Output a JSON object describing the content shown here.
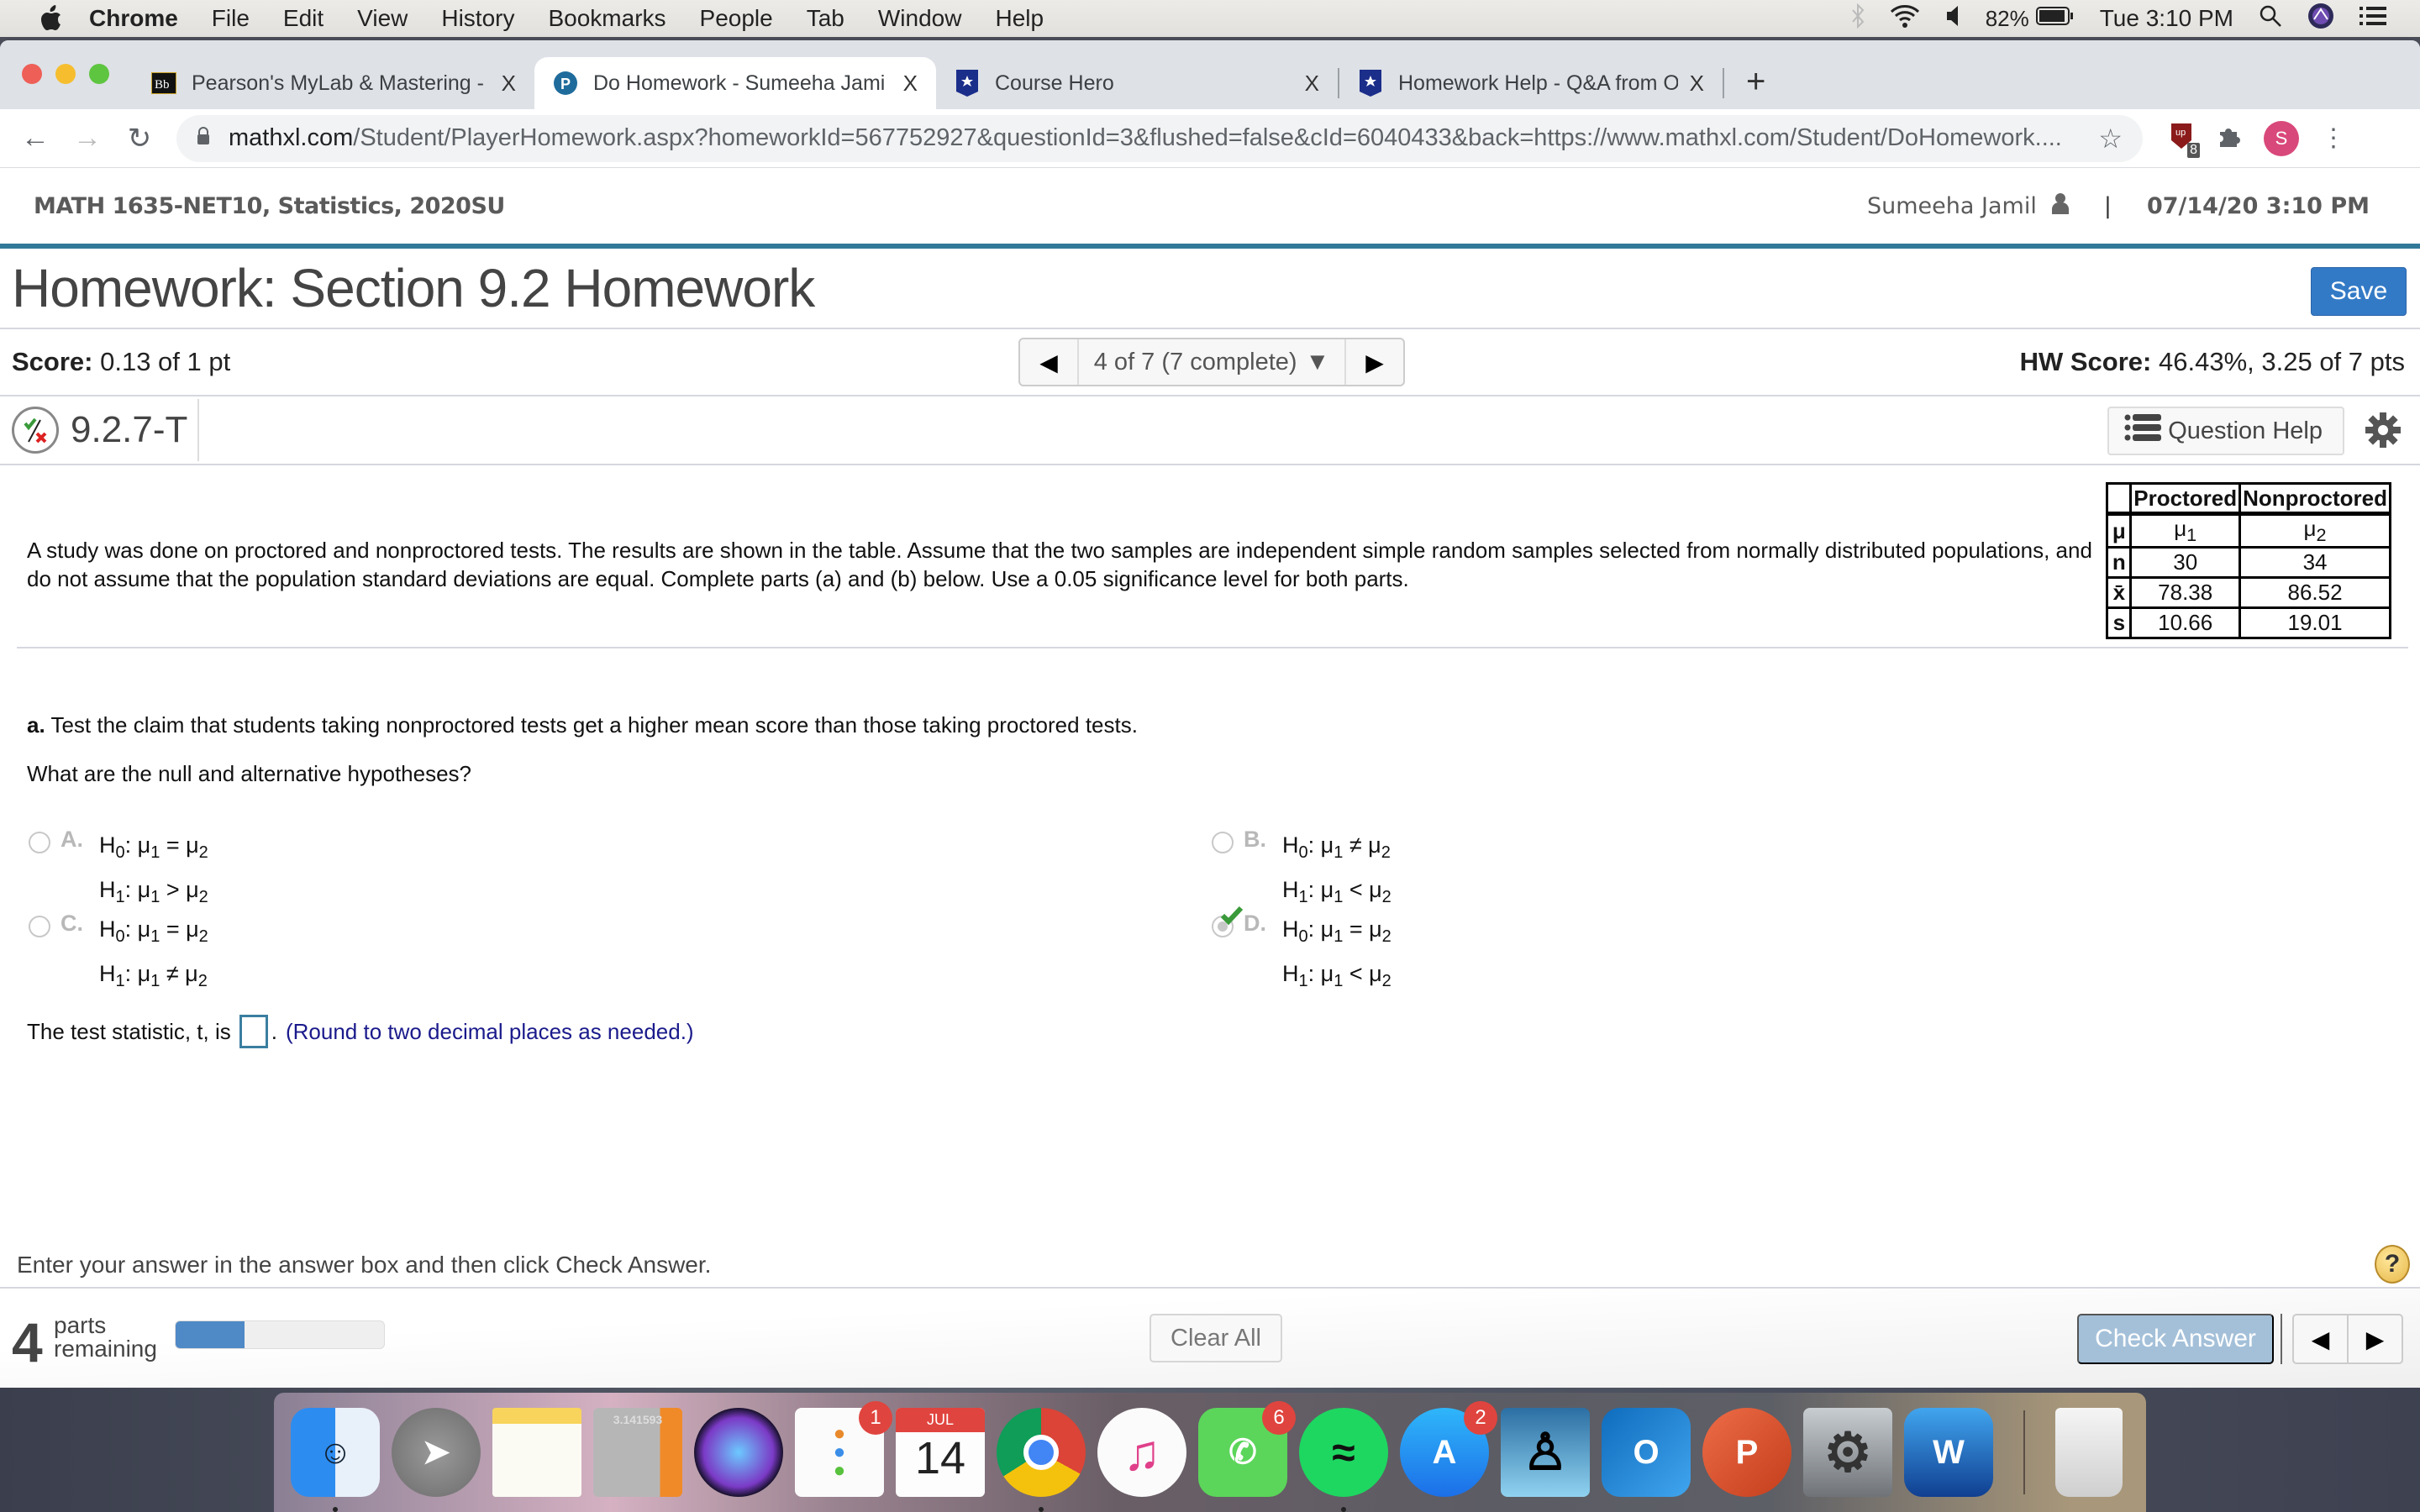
{
  "menubar": {
    "items": [
      "Chrome",
      "File",
      "Edit",
      "View",
      "History",
      "Bookmarks",
      "People",
      "Tab",
      "Window",
      "Help"
    ],
    "battery": "82%",
    "clock": "Tue 3:10 PM"
  },
  "browser": {
    "tabs": [
      {
        "title": "Pearson's MyLab & Mastering -",
        "favicon": "blackboard-icon",
        "active": false
      },
      {
        "title": "Do Homework - Sumeeha Jami",
        "favicon": "pearson-icon",
        "active": true
      },
      {
        "title": "Course Hero",
        "favicon": "coursehero-icon",
        "active": false
      },
      {
        "title": "Homework Help - Q&A from Or",
        "favicon": "coursehero-icon",
        "active": false
      }
    ],
    "close_glyph": "X",
    "new_tab_glyph": "+",
    "url_host": "mathxl.com",
    "url_path": "/Student/PlayerHomework.aspx?homeworkId=567752927&questionId=3&flushed=false&cId=6040433&back=https://www.mathxl.com/Student/DoHomework....",
    "extension_badge": "8",
    "profile_initial": "S"
  },
  "header": {
    "course": "MATH 1635-NET10, Statistics, 2020SU",
    "user": "Sumeeha Jamil",
    "datetime": "07/14/20 3:10 PM",
    "separator": "|"
  },
  "homework": {
    "title": "Homework: Section 9.2 Homework",
    "save_label": "Save",
    "score_label": "Score:",
    "score_value": "0.13 of 1 pt",
    "nav_position": "4 of 7 (7 complete)",
    "hw_score_label": "HW Score:",
    "hw_score_value": "46.43%, 3.25 of 7 pts",
    "question_id": "9.2.7-T",
    "question_help_label": "Question Help"
  },
  "problem": {
    "text": "A study was done on proctored and nonproctored tests. The results are shown in the table. Assume that the two samples are independent simple random samples selected from normally distributed populations, and do not assume that the population standard deviations are equal. Complete parts (a) and (b) below. Use a 0.05 significance level for both parts.",
    "table": {
      "headers": [
        "",
        "Proctored",
        "Nonproctored"
      ],
      "rows": [
        {
          "label": "μ",
          "c1": "μ",
          "c1_sub": "1",
          "c2": "μ",
          "c2_sub": "2"
        },
        {
          "label": "n",
          "c1": "30",
          "c2": "34"
        },
        {
          "label": "x̄",
          "c1": "78.38",
          "c2": "86.52"
        },
        {
          "label": "s",
          "c1": "10.66",
          "c2": "19.01"
        }
      ]
    }
  },
  "part_a": {
    "label": "a.",
    "claim": " Test the claim that students taking nonproctored tests get a higher mean score than those taking proctored tests.",
    "question": "What are the null and alternative hypotheses?",
    "options": [
      {
        "letter": "A.",
        "h0_op": "=",
        "h1_op": ">",
        "selected": false,
        "correct": false
      },
      {
        "letter": "B.",
        "h0_op": "≠",
        "h1_op": "<",
        "selected": false,
        "correct": false
      },
      {
        "letter": "C.",
        "h0_op": "=",
        "h1_op": "≠",
        "selected": false,
        "correct": false
      },
      {
        "letter": "D.",
        "h0_op": "=",
        "h1_op": "<",
        "selected": true,
        "correct": true
      }
    ],
    "tstat_prefix": "The test statistic, t, is",
    "tstat_value": "",
    "tstat_suffix": ".",
    "tstat_hint": "(Round to two decimal places as needed.)"
  },
  "footer": {
    "instruction": "Enter your answer in the answer box and then click Check Answer.",
    "parts_remaining": "4",
    "parts_label_1": "parts",
    "parts_label_2": "remaining",
    "progress_fraction": 0.33,
    "clear_all_label": "Clear All",
    "check_answer_label": "Check Answer",
    "help_glyph": "?"
  },
  "dock": {
    "apps": [
      {
        "name": "Finder",
        "badge": null,
        "running": true
      },
      {
        "name": "Launchpad",
        "badge": null,
        "running": false
      },
      {
        "name": "Notes",
        "badge": null,
        "running": false
      },
      {
        "name": "Calculator",
        "badge": null,
        "running": false,
        "display": "3.141593"
      },
      {
        "name": "Siri",
        "badge": null,
        "running": false
      },
      {
        "name": "Reminders",
        "badge": "1",
        "running": false
      },
      {
        "name": "Calendar",
        "badge": null,
        "running": false,
        "month": "JUL",
        "day": "14"
      },
      {
        "name": "Chrome",
        "badge": null,
        "running": true
      },
      {
        "name": "iTunes",
        "badge": null,
        "running": false
      },
      {
        "name": "FaceTime",
        "badge": "6",
        "running": false
      },
      {
        "name": "Spotify",
        "badge": null,
        "running": true
      },
      {
        "name": "App Store",
        "badge": "2",
        "running": false
      },
      {
        "name": "Kindle",
        "badge": null,
        "running": false
      },
      {
        "name": "Outlook",
        "badge": null,
        "running": false,
        "letter": "O"
      },
      {
        "name": "PowerPoint",
        "badge": null,
        "running": false,
        "letter": "P"
      },
      {
        "name": "System Preferences",
        "badge": null,
        "running": false
      },
      {
        "name": "Word",
        "badge": null,
        "running": false,
        "letter": "W"
      },
      {
        "name": "Trash",
        "badge": null,
        "running": false
      }
    ]
  }
}
